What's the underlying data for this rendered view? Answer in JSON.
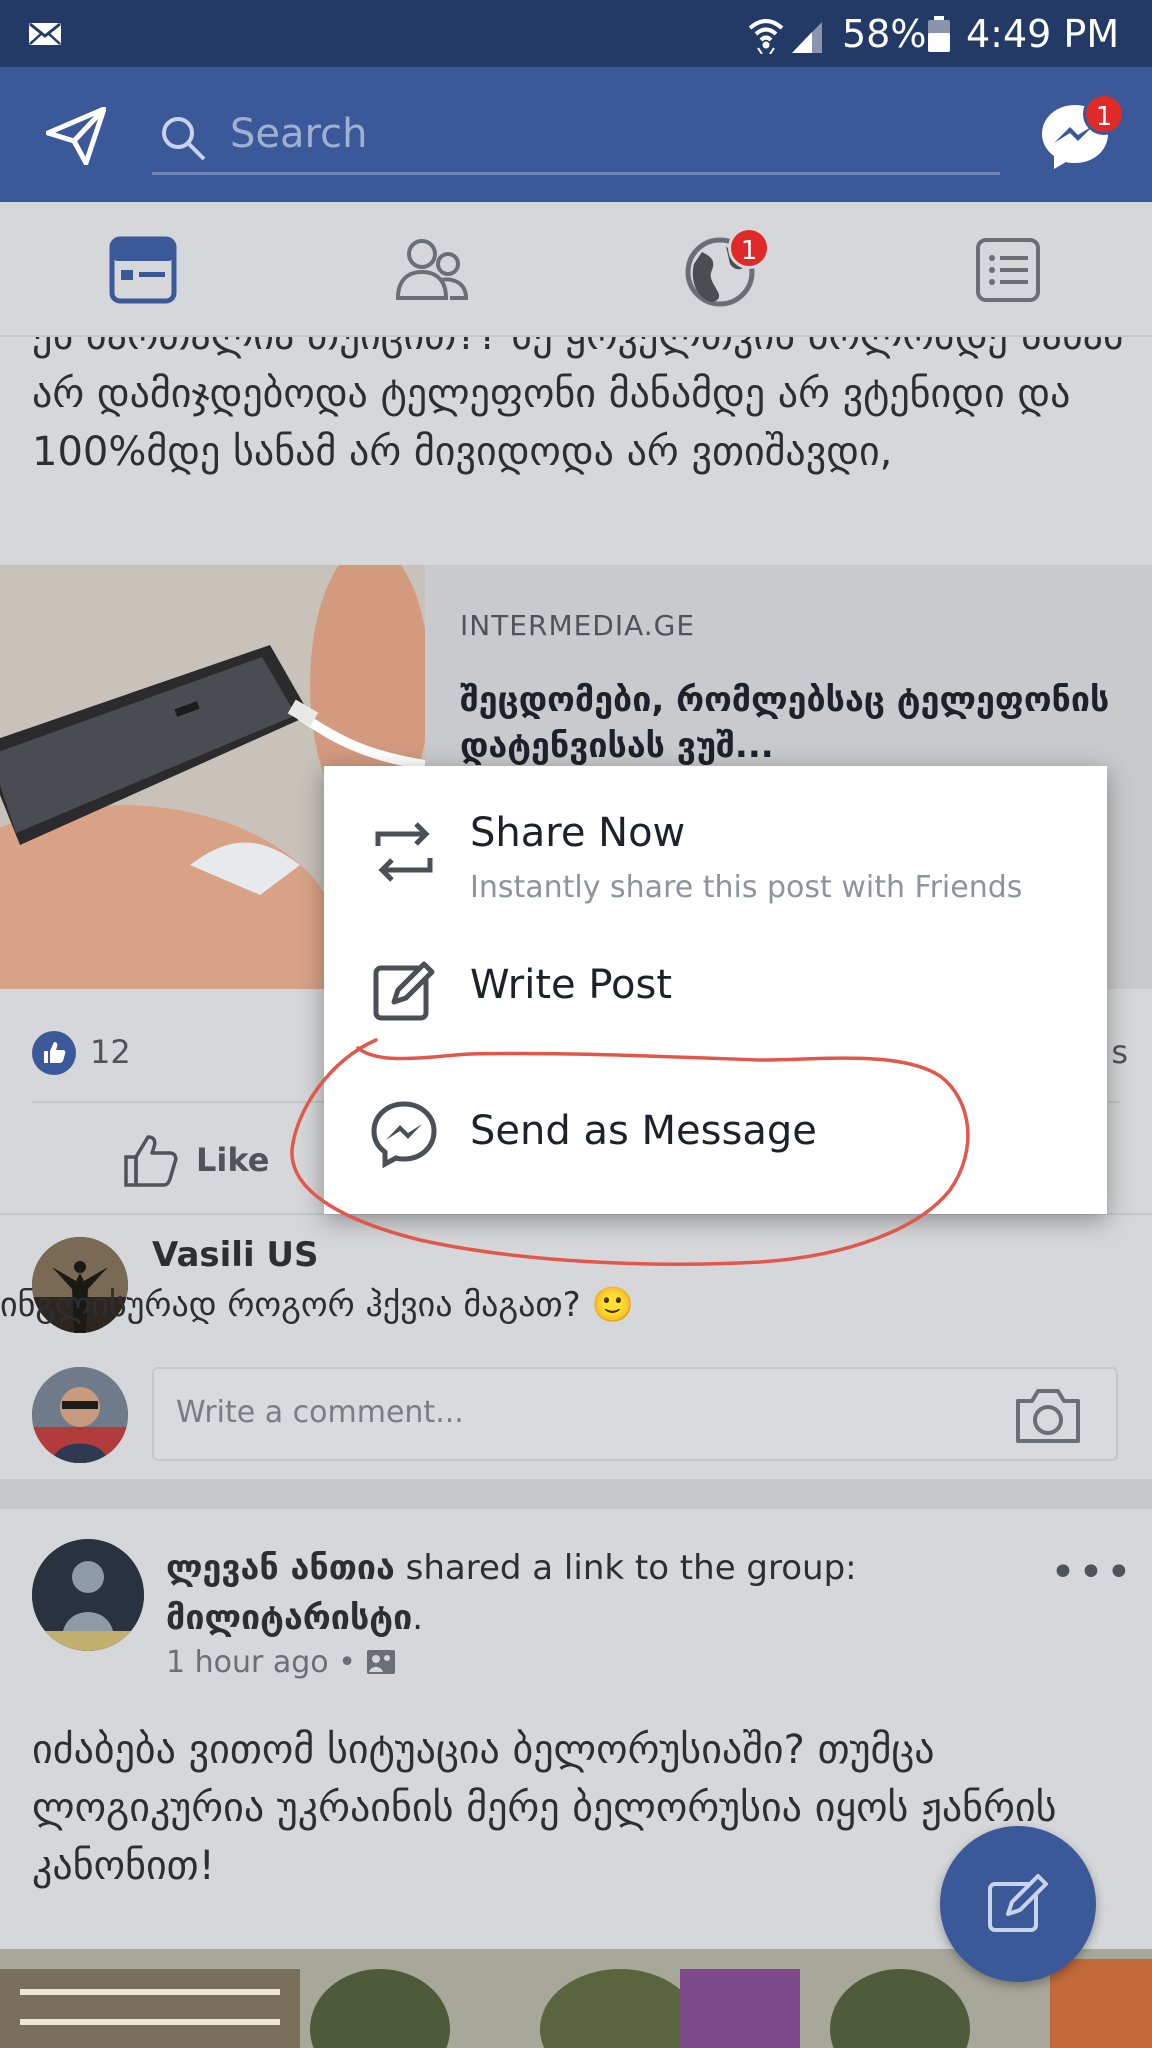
{
  "status_bar": {
    "battery": "58%",
    "time": "4:49 PM"
  },
  "header": {
    "search_placeholder": "Search",
    "messenger_badge": "1"
  },
  "tabs": {
    "items": [
      "news-feed",
      "friends",
      "notifications",
      "menu"
    ],
    "notifications_badge": "1"
  },
  "post1": {
    "text": "ეს ბაოთალია თუიცით?? მე ყოველთვის ბოლომდე სანამ არ დამიჯდებოდა ტელეფონი მანამდე არ ვტენიდი და 100%მდე სანამ არ მივიდოდა არ ვთიშავდი,",
    "link_source": "INTERMEDIA.GE",
    "link_title": "შეცდომები, რომლებსაც ტელეფონის დატენვისას ვუშ...",
    "likes_count": "12",
    "trailing_fragment": "s",
    "like_label": "Like"
  },
  "comment": {
    "author": "Vasili US",
    "text": "ინგლისურად როგორ ჰქვია მაგათ?",
    "emoji": "🙂"
  },
  "composer": {
    "placeholder": "Write a comment..."
  },
  "post2": {
    "author": "ლევან ანთია",
    "action": " shared a link to the group: ",
    "group": "მილიტარისტი",
    "group_suffix": ".",
    "time": "1 hour ago",
    "separator": "•",
    "text": "იძაბება ვითომ სიტუაცია ბელორუსიაში? თუმცა ლოგიკურია უკრაინის მერე ბელორუსია იყოს ჟანრის კანონით!"
  },
  "share_menu": {
    "items": [
      {
        "title": "Share Now",
        "subtitle": "Instantly share this post with Friends"
      },
      {
        "title": "Write Post",
        "subtitle": ""
      },
      {
        "title": "Send as Message",
        "subtitle": ""
      }
    ]
  },
  "colors": {
    "brand": "#3b5999",
    "status_bar": "#233a66",
    "badge": "#e02a2a",
    "annotation": "#e2574c"
  }
}
